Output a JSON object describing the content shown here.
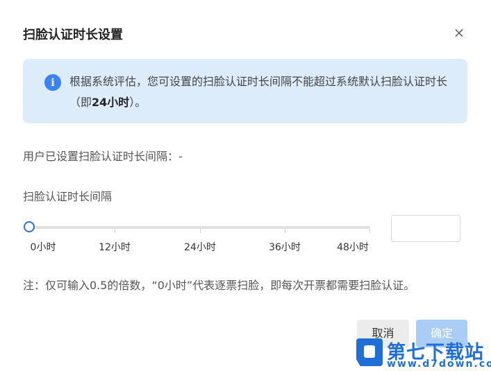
{
  "dialog": {
    "title": "扫脸认证时长设置",
    "close_glyph": "×"
  },
  "notice": {
    "icon": "info-icon",
    "icon_glyph": "i",
    "text_before": "根据系统评估，您可设置的扫脸认证时长间隔不能超过系统默认扫脸认证时长（即",
    "text_bold": "24小时",
    "text_after": "）。"
  },
  "current_setting": "用户已设置扫脸认证时长间隔：-",
  "slider": {
    "label": "扫脸认证时长间隔",
    "value_hours": 0,
    "max_hours": 48,
    "marks": [
      "0小时",
      "12小时",
      "24小时",
      "36小时",
      "48小时"
    ],
    "input_value": ""
  },
  "note": "注：仅可输入0.5的倍数，“0小时”代表逐票扫脸，即每次开票都需要扫脸认证。",
  "buttons": {
    "cancel": "取消",
    "confirm": "确定"
  },
  "watermark": {
    "name": "第七下载站",
    "url": "www.d7down.com"
  },
  "colors": {
    "accent": "#2f6fde",
    "notice_bg": "#dcecfb",
    "confirm_disabled": "#a9cdf5",
    "watermark": "#1f6fd6"
  }
}
